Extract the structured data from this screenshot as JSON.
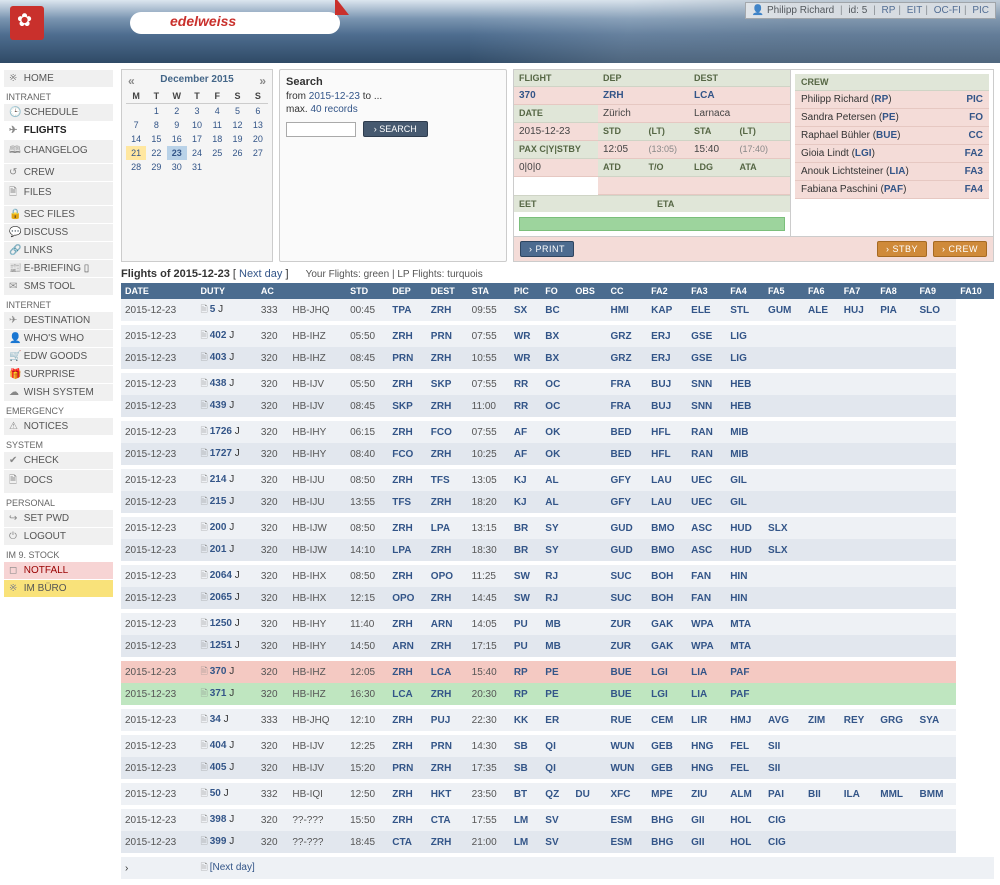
{
  "topbar": {
    "user_icon": "👤",
    "user_name": "Philipp Richard",
    "id_label": "id: 5",
    "links": [
      "RP",
      "EIT",
      "OC-FI",
      "PIC"
    ]
  },
  "sidebar": {
    "groups": [
      {
        "head": "",
        "items": [
          {
            "ico": "※",
            "label": "HOME"
          }
        ]
      },
      {
        "head": "INTRANET",
        "items": [
          {
            "ico": "🕒",
            "label": "SCHEDULE"
          },
          {
            "ico": "✈",
            "label": "FLIGHTS",
            "active": true
          },
          {
            "ico": "🕮",
            "label": "CHANGELOG"
          },
          {
            "ico": "↺",
            "label": "CREW"
          },
          {
            "ico": "🗎",
            "label": "FILES"
          },
          {
            "ico": "🔒",
            "label": "SEC FILES"
          },
          {
            "ico": "💬",
            "label": "DISCUSS"
          },
          {
            "ico": "🔗",
            "label": "LINKS"
          },
          {
            "ico": "📰",
            "label": "E-BRIEFING ▯"
          },
          {
            "ico": "✉",
            "label": "SMS TOOL"
          }
        ]
      },
      {
        "head": "INTERNET",
        "items": [
          {
            "ico": "✈",
            "label": "DESTINATION"
          },
          {
            "ico": "👤",
            "label": "WHO'S WHO"
          },
          {
            "ico": "🛒",
            "label": "EDW GOODS"
          },
          {
            "ico": "🎁",
            "label": "SURPRISE"
          },
          {
            "ico": "☁",
            "label": "WISH SYSTEM"
          }
        ]
      },
      {
        "head": "EMERGENCY",
        "items": [
          {
            "ico": "⚠",
            "label": "NOTICES"
          }
        ]
      },
      {
        "head": "SYSTEM",
        "items": [
          {
            "ico": "✔",
            "label": "CHECK"
          },
          {
            "ico": "🗎",
            "label": "DOCS"
          }
        ]
      },
      {
        "head": "PERSONAL",
        "items": [
          {
            "ico": "↪",
            "label": "SET PWD"
          },
          {
            "ico": "⏻",
            "label": "LOGOUT"
          }
        ]
      },
      {
        "head": "IM 9. STOCK",
        "items": [
          {
            "ico": "◻",
            "label": "NOTFALL",
            "cls": "side-emerg1"
          },
          {
            "ico": "※",
            "label": "IM BÜRO",
            "cls": "side-emerg2"
          }
        ]
      }
    ]
  },
  "calendar": {
    "title": "December 2015",
    "dow": [
      "M",
      "T",
      "W",
      "T",
      "F",
      "S",
      "S"
    ],
    "weeks": [
      [
        "",
        "1",
        "2",
        "3",
        "4",
        "5",
        "6"
      ],
      [
        "7",
        "8",
        "9",
        "10",
        "11",
        "12",
        "13"
      ],
      [
        "14",
        "15",
        "16",
        "17",
        "18",
        "19",
        "20"
      ],
      [
        "21",
        "22",
        "23",
        "24",
        "25",
        "26",
        "27"
      ],
      [
        "28",
        "29",
        "30",
        "31",
        "",
        "",
        ""
      ]
    ],
    "hl_y": "21",
    "hl_b": "23"
  },
  "search": {
    "title": "Search",
    "line1a": "from ",
    "line1_link": "2015-12-23",
    "line1b": " to ...",
    "line2a": "max. ",
    "line2_link": "40 records",
    "btn": "› SEARCH"
  },
  "detail": {
    "labels": {
      "flight": "FLIGHT",
      "date": "DATE",
      "pax": "PAX C|Y|STBY",
      "dep": "DEP",
      "dest": "DEST",
      "std": "STD",
      "lt": "(LT)",
      "sta": "STA",
      "atd": "ATD",
      "to": "T/O",
      "ldg": "LDG",
      "ata": "ATA",
      "eet": "EET",
      "eta": "ETA",
      "crew": "CREW"
    },
    "flight": "370",
    "date": "2015-12-23",
    "pax": "0|0|0",
    "dep": "ZRH",
    "dep_city": "Zürich",
    "dest": "LCA",
    "dest_city": "Larnaca",
    "std": "12:05",
    "std_lt": "(13:05)",
    "sta": "15:40",
    "sta_lt": "(17:40)",
    "crew": [
      {
        "name": "Philipp Richard",
        "short": "RP",
        "role": "PIC"
      },
      {
        "name": "Sandra Petersen",
        "short": "PE",
        "role": "FO"
      },
      {
        "name": "Raphael Bühler",
        "short": "BUE",
        "role": "CC"
      },
      {
        "name": "Gioia Lindt",
        "short": "LGI",
        "role": "FA2"
      },
      {
        "name": "Anouk Lichtsteiner",
        "short": "LIA",
        "role": "FA3"
      },
      {
        "name": "Fabiana Paschini",
        "short": "PAF",
        "role": "FA4"
      }
    ],
    "btn_print": "› PRINT",
    "btn_stby": "› STBY",
    "btn_crew": "› CREW"
  },
  "flights_header": {
    "title_a": "Flights of ",
    "date": "2015-12-23",
    "title_b": " [ ",
    "nextday": "Next day",
    "title_c": " ]",
    "legend": "Your Flights: green | LP Flights: turquois",
    "cols": [
      "DATE",
      "DUTY",
      "AC",
      "",
      "STD",
      "DEP",
      "DEST",
      "STA",
      "PIC",
      "FO",
      "OBS",
      "CC",
      "FA2",
      "FA3",
      "FA4",
      "FA5",
      "FA6",
      "FA7",
      "FA8",
      "FA9",
      "FA10"
    ]
  },
  "groups": [
    [
      {
        "date": "2015-12-23",
        "duty": "5",
        "suf": "J",
        "ac": "333",
        "reg": "HB-JHQ",
        "std": "00:45",
        "dep": "TPA",
        "dest": "ZRH",
        "sta": "09:55",
        "crew": [
          "SX",
          "BC",
          "",
          "HMI",
          "KAP",
          "ELE",
          "STL",
          "GUM",
          "ALE",
          "HUJ",
          "PIA",
          "SLO"
        ]
      }
    ],
    [
      {
        "date": "2015-12-23",
        "duty": "402",
        "suf": "J",
        "ac": "320",
        "reg": "HB-IHZ",
        "std": "05:50",
        "dep": "ZRH",
        "dest": "PRN",
        "sta": "07:55",
        "crew": [
          "WR",
          "BX",
          "",
          "GRZ",
          "ERJ",
          "GSE",
          "LIG",
          "",
          "",
          "",
          "",
          ""
        ]
      },
      {
        "date": "2015-12-23",
        "duty": "403",
        "suf": "J",
        "ac": "320",
        "reg": "HB-IHZ",
        "std": "08:45",
        "dep": "PRN",
        "dest": "ZRH",
        "sta": "10:55",
        "crew": [
          "WR",
          "BX",
          "",
          "GRZ",
          "ERJ",
          "GSE",
          "LIG",
          "",
          "",
          "",
          "",
          ""
        ]
      }
    ],
    [
      {
        "date": "2015-12-23",
        "duty": "438",
        "suf": "J",
        "ac": "320",
        "reg": "HB-IJV",
        "std": "05:50",
        "dep": "ZRH",
        "dest": "SKP",
        "sta": "07:55",
        "crew": [
          "RR",
          "OC",
          "",
          "FRA",
          "BUJ",
          "SNN",
          "HEB",
          "",
          "",
          "",
          "",
          ""
        ]
      },
      {
        "date": "2015-12-23",
        "duty": "439",
        "suf": "J",
        "ac": "320",
        "reg": "HB-IJV",
        "std": "08:45",
        "dep": "SKP",
        "dest": "ZRH",
        "sta": "11:00",
        "crew": [
          "RR",
          "OC",
          "",
          "FRA",
          "BUJ",
          "SNN",
          "HEB",
          "",
          "",
          "",
          "",
          ""
        ]
      }
    ],
    [
      {
        "date": "2015-12-23",
        "duty": "1726",
        "suf": "J",
        "ac": "320",
        "reg": "HB-IHY",
        "std": "06:15",
        "dep": "ZRH",
        "dest": "FCO",
        "sta": "07:55",
        "crew": [
          "AF",
          "OK",
          "",
          "BED",
          "HFL",
          "RAN",
          "MIB",
          "",
          "",
          "",
          "",
          ""
        ]
      },
      {
        "date": "2015-12-23",
        "duty": "1727",
        "suf": "J",
        "ac": "320",
        "reg": "HB-IHY",
        "std": "08:40",
        "dep": "FCO",
        "dest": "ZRH",
        "sta": "10:25",
        "crew": [
          "AF",
          "OK",
          "",
          "BED",
          "HFL",
          "RAN",
          "MIB",
          "",
          "",
          "",
          "",
          ""
        ]
      }
    ],
    [
      {
        "date": "2015-12-23",
        "duty": "214",
        "suf": "J",
        "ac": "320",
        "reg": "HB-IJU",
        "std": "08:50",
        "dep": "ZRH",
        "dest": "TFS",
        "sta": "13:05",
        "crew": [
          "KJ",
          "AL",
          "",
          "GFY",
          "LAU",
          "UEC",
          "GIL",
          "",
          "",
          "",
          "",
          ""
        ]
      },
      {
        "date": "2015-12-23",
        "duty": "215",
        "suf": "J",
        "ac": "320",
        "reg": "HB-IJU",
        "std": "13:55",
        "dep": "TFS",
        "dest": "ZRH",
        "sta": "18:20",
        "crew": [
          "KJ",
          "AL",
          "",
          "GFY",
          "LAU",
          "UEC",
          "GIL",
          "",
          "",
          "",
          "",
          ""
        ]
      }
    ],
    [
      {
        "date": "2015-12-23",
        "duty": "200",
        "suf": "J",
        "ac": "320",
        "reg": "HB-IJW",
        "std": "08:50",
        "dep": "ZRH",
        "dest": "LPA",
        "sta": "13:15",
        "crew": [
          "BR",
          "SY",
          "",
          "GUD",
          "BMO",
          "ASC",
          "HUD",
          "SLX",
          "",
          "",
          "",
          ""
        ]
      },
      {
        "date": "2015-12-23",
        "duty": "201",
        "suf": "J",
        "ac": "320",
        "reg": "HB-IJW",
        "std": "14:10",
        "dep": "LPA",
        "dest": "ZRH",
        "sta": "18:30",
        "crew": [
          "BR",
          "SY",
          "",
          "GUD",
          "BMO",
          "ASC",
          "HUD",
          "SLX",
          "",
          "",
          "",
          ""
        ]
      }
    ],
    [
      {
        "date": "2015-12-23",
        "duty": "2064",
        "suf": "J",
        "ac": "320",
        "reg": "HB-IHX",
        "std": "08:50",
        "dep": "ZRH",
        "dest": "OPO",
        "sta": "11:25",
        "crew": [
          "SW",
          "RJ",
          "",
          "SUC",
          "BOH",
          "FAN",
          "HIN",
          "",
          "",
          "",
          "",
          ""
        ]
      },
      {
        "date": "2015-12-23",
        "duty": "2065",
        "suf": "J",
        "ac": "320",
        "reg": "HB-IHX",
        "std": "12:15",
        "dep": "OPO",
        "dest": "ZRH",
        "sta": "14:45",
        "crew": [
          "SW",
          "RJ",
          "",
          "SUC",
          "BOH",
          "FAN",
          "HIN",
          "",
          "",
          "",
          "",
          ""
        ]
      }
    ],
    [
      {
        "date": "2015-12-23",
        "duty": "1250",
        "suf": "J",
        "ac": "320",
        "reg": "HB-IHY",
        "std": "11:40",
        "dep": "ZRH",
        "dest": "ARN",
        "sta": "14:05",
        "crew": [
          "PU",
          "MB",
          "",
          "ZUR",
          "GAK",
          "WPA",
          "MTA",
          "",
          "",
          "",
          "",
          ""
        ]
      },
      {
        "date": "2015-12-23",
        "duty": "1251",
        "suf": "J",
        "ac": "320",
        "reg": "HB-IHY",
        "std": "14:50",
        "dep": "ARN",
        "dest": "ZRH",
        "sta": "17:15",
        "crew": [
          "PU",
          "MB",
          "",
          "ZUR",
          "GAK",
          "WPA",
          "MTA",
          "",
          "",
          "",
          "",
          ""
        ]
      }
    ],
    [
      {
        "date": "2015-12-23",
        "duty": "370",
        "suf": "J",
        "ac": "320",
        "reg": "HB-IHZ",
        "std": "12:05",
        "dep": "ZRH",
        "dest": "LCA",
        "sta": "15:40",
        "crew": [
          "RP",
          "PE",
          "",
          "BUE",
          "LGI",
          "LIA",
          "PAF",
          "",
          "",
          "",
          "",
          ""
        ],
        "cls": "sel-red"
      },
      {
        "date": "2015-12-23",
        "duty": "371",
        "suf": "J",
        "ac": "320",
        "reg": "HB-IHZ",
        "std": "16:30",
        "dep": "LCA",
        "dest": "ZRH",
        "sta": "20:30",
        "crew": [
          "RP",
          "PE",
          "",
          "BUE",
          "LGI",
          "LIA",
          "PAF",
          "",
          "",
          "",
          "",
          ""
        ],
        "cls": "sel-grn"
      }
    ],
    [
      {
        "date": "2015-12-23",
        "duty": "34",
        "suf": "J",
        "ac": "333",
        "reg": "HB-JHQ",
        "std": "12:10",
        "dep": "ZRH",
        "dest": "PUJ",
        "sta": "22:30",
        "crew": [
          "KK",
          "ER",
          "",
          "RUE",
          "CEM",
          "LIR",
          "HMJ",
          "AVG",
          "ZIM",
          "REY",
          "GRG",
          "SYA"
        ]
      }
    ],
    [
      {
        "date": "2015-12-23",
        "duty": "404",
        "suf": "J",
        "ac": "320",
        "reg": "HB-IJV",
        "std": "12:25",
        "dep": "ZRH",
        "dest": "PRN",
        "sta": "14:30",
        "crew": [
          "SB",
          "QI",
          "",
          "WUN",
          "GEB",
          "HNG",
          "FEL",
          "SII",
          "",
          "",
          "",
          ""
        ]
      },
      {
        "date": "2015-12-23",
        "duty": "405",
        "suf": "J",
        "ac": "320",
        "reg": "HB-IJV",
        "std": "15:20",
        "dep": "PRN",
        "dest": "ZRH",
        "sta": "17:35",
        "crew": [
          "SB",
          "QI",
          "",
          "WUN",
          "GEB",
          "HNG",
          "FEL",
          "SII",
          "",
          "",
          "",
          ""
        ]
      }
    ],
    [
      {
        "date": "2015-12-23",
        "duty": "50",
        "suf": "J",
        "ac": "332",
        "reg": "HB-IQI",
        "std": "12:50",
        "dep": "ZRH",
        "dest": "HKT",
        "sta": "23:50",
        "crew": [
          "BT",
          "QZ",
          "DU",
          "XFC",
          "MPE",
          "ZIU",
          "ALM",
          "PAI",
          "BII",
          "ILA",
          "MML",
          "BMM"
        ]
      }
    ],
    [
      {
        "date": "2015-12-23",
        "duty": "398",
        "suf": "J",
        "ac": "320",
        "reg": "??-???",
        "std": "15:50",
        "dep": "ZRH",
        "dest": "CTA",
        "sta": "17:55",
        "crew": [
          "LM",
          "SV",
          "",
          "ESM",
          "BHG",
          "GII",
          "HOL",
          "CIG",
          "",
          "",
          "",
          ""
        ]
      },
      {
        "date": "2015-12-23",
        "duty": "399",
        "suf": "J",
        "ac": "320",
        "reg": "??-???",
        "std": "18:45",
        "dep": "CTA",
        "dest": "ZRH",
        "sta": "21:00",
        "crew": [
          "LM",
          "SV",
          "",
          "ESM",
          "BHG",
          "GII",
          "HOL",
          "CIG",
          "",
          "",
          "",
          ""
        ]
      }
    ]
  ],
  "nextday_row": "[Next day]",
  "arrow": "›"
}
